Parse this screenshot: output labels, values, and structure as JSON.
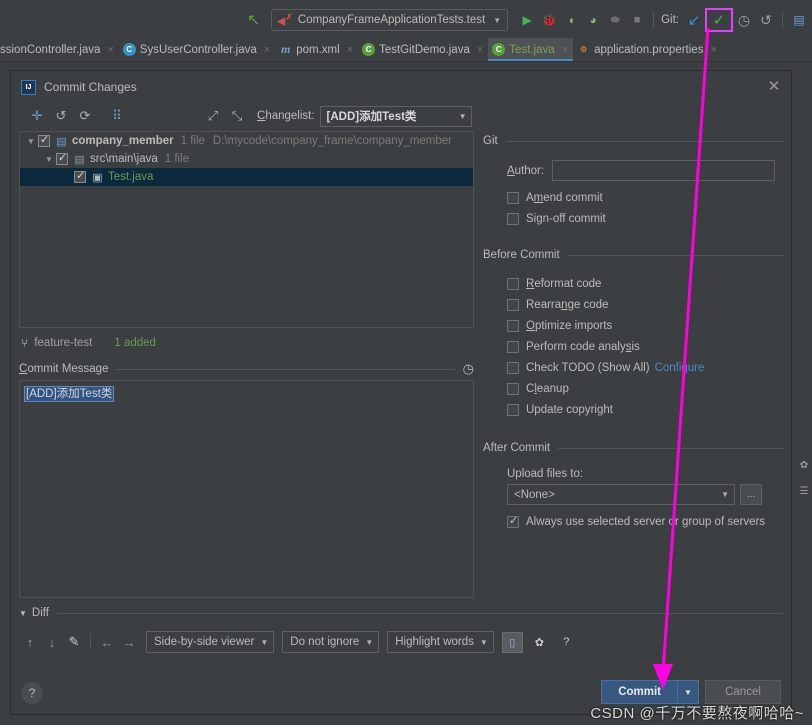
{
  "ide_toolbar": {
    "back_icon": "back-arrow-icon",
    "run_config": {
      "label": "CompanyFrameApplicationTests.test",
      "icon": "test-config-icon",
      "caret": "▼"
    },
    "actions": [
      {
        "name": "run-icon",
        "glyph": "▶",
        "color": "#4caf50"
      },
      {
        "name": "debug-icon",
        "glyph": "🐞",
        "color": "#9fbf58"
      },
      {
        "name": "run-coverage-icon",
        "glyph": "◖",
        "color": "#8fb573"
      },
      {
        "name": "profile-icon",
        "glyph": "◐",
        "color": "#8fb573"
      },
      {
        "name": "attach-icon",
        "glyph": "⬬",
        "color": "#6d6d6d"
      },
      {
        "name": "stop-icon",
        "glyph": "■",
        "color": "#7a7a7a"
      }
    ],
    "git_label": "Git:",
    "git_actions": [
      {
        "name": "update-project-icon",
        "glyph": "↙",
        "color": "#3b8bd6"
      },
      {
        "name": "commit-icon",
        "glyph": "✓",
        "color": "#4caf50",
        "highlighted": true
      },
      {
        "name": "history-icon",
        "glyph": "◷",
        "color": "#bbbbbb"
      },
      {
        "name": "rollback-icon",
        "glyph": "↺",
        "color": "#bbbbbb"
      }
    ],
    "trailing_icon": "project-structure-icon"
  },
  "editor_tabs": [
    {
      "label": "ssionController.java",
      "icon": "class-icon",
      "icon_kind": "cls",
      "icon_text": "C",
      "active": false,
      "close": "×"
    },
    {
      "label": "SysUserController.java",
      "icon": "class-icon",
      "icon_kind": "cls",
      "icon_text": "C",
      "active": false,
      "close": "×"
    },
    {
      "label": "pom.xml",
      "icon": "maven-icon",
      "icon_kind": "maven",
      "icon_text": "m",
      "active": false,
      "close": "×"
    },
    {
      "label": "TestGitDemo.java",
      "icon": "class-icon",
      "icon_kind": "cls-green",
      "icon_text": "C",
      "active": false,
      "close": "×"
    },
    {
      "label": "Test.java",
      "icon": "class-icon",
      "icon_kind": "cls-green",
      "icon_text": "C",
      "active": true,
      "close": "×"
    },
    {
      "label": "application.properties",
      "icon": "properties-icon",
      "icon_kind": "props",
      "icon_text": "⚙",
      "active": false,
      "close": "×"
    }
  ],
  "dialog": {
    "title": "Commit Changes",
    "app_icon": "intellij-idea-icon",
    "close_label": "✕",
    "toolbar": {
      "icons": [
        {
          "name": "add-to-changelist-icon",
          "glyph": "✛"
        },
        {
          "name": "revert-icon",
          "glyph": "↺"
        },
        {
          "name": "refresh-icon",
          "glyph": "⟳"
        },
        {
          "name": "group-by-icon",
          "glyph": "⠿"
        },
        {
          "name": "expand-all-icon",
          "glyph": "⤢"
        },
        {
          "name": "collapse-all-icon",
          "glyph": "⤡"
        }
      ],
      "changelist_label": "Changelist:",
      "changelist_value": "[ADD]添加Test类",
      "changelist_caret": "▼"
    },
    "tree": [
      {
        "indent": 0,
        "twisty": "▼",
        "checked": true,
        "icon": "module-icon",
        "icon_glyph": "▤",
        "name": "company_member",
        "bold": true,
        "green": false,
        "meta": "1 file",
        "path": "D:\\mycode\\company_frame\\company_member",
        "selected": false
      },
      {
        "indent": 1,
        "twisty": "▼",
        "checked": true,
        "icon": "folder-icon",
        "icon_glyph": "▤",
        "name": "src\\main\\java",
        "bold": false,
        "green": false,
        "meta": "1 file",
        "path": "",
        "selected": false
      },
      {
        "indent": 2,
        "twisty": "",
        "checked": true,
        "icon": "java-file-icon",
        "icon_glyph": "▣",
        "name": "Test.java",
        "bold": false,
        "green": true,
        "meta": "",
        "path": "",
        "selected": true
      }
    ],
    "branch": {
      "icon": "branch-icon",
      "glyph": "⑂",
      "name": "feature-test",
      "added": "1 added"
    },
    "commit_message": {
      "label_prefix": "C",
      "label_rest": "ommit Message",
      "history_icon": "clock-icon",
      "history_glyph": "◷",
      "value": "[ADD]添加Test类"
    },
    "git_section": {
      "title": "Git",
      "author_label_prefix": "A",
      "author_label_rest": "uthor:",
      "author_value": "",
      "checkboxes": [
        {
          "label_pre": "A",
          "label_key": "m",
          "label_post": "end commit",
          "checked": false,
          "name": "amend-commit-checkbox"
        },
        {
          "label_pre": "Sign-off commit",
          "label_key": "",
          "label_post": "",
          "checked": false,
          "name": "sign-off-commit-checkbox"
        }
      ]
    },
    "before_commit": {
      "title": "Before Commit",
      "items": [
        {
          "label": "Reformat code",
          "checked": false,
          "link": "",
          "name": "reformat-code-checkbox"
        },
        {
          "label": "Rearrange code",
          "checked": false,
          "link": "",
          "name": "rearrange-code-checkbox"
        },
        {
          "label": "Optimize imports",
          "checked": false,
          "link": "",
          "name": "optimize-imports-checkbox"
        },
        {
          "label": "Perform code analysis",
          "checked": false,
          "link": "",
          "name": "perform-code-analysis-checkbox"
        },
        {
          "label": "Check TODO (Show All)",
          "checked": false,
          "link": "Configure",
          "name": "check-todo-checkbox"
        },
        {
          "label": "Cleanup",
          "checked": false,
          "link": "",
          "name": "cleanup-checkbox"
        },
        {
          "label": "Update copyright",
          "checked": false,
          "link": "",
          "name": "update-copyright-checkbox"
        }
      ]
    },
    "after_commit": {
      "title": "After Commit",
      "upload_label": "Upload files to:",
      "upload_value": "<None>",
      "upload_caret": "▼",
      "browse_label": "...",
      "always_use_label": "Always use selected server or group of servers",
      "always_use_checked": true
    },
    "diff": {
      "title": "Diff",
      "twisty": "▼",
      "nav_icons": [
        {
          "name": "previous-difference-icon",
          "glyph": "↑"
        },
        {
          "name": "next-difference-icon",
          "glyph": "↓"
        },
        {
          "name": "edit-source-icon",
          "glyph": "✎"
        },
        {
          "name": "apply-left-icon",
          "glyph": "←"
        },
        {
          "name": "apply-right-icon",
          "glyph": "→"
        }
      ],
      "viewer_mode": "Side-by-side viewer",
      "ignore_mode": "Do not ignore",
      "highlight_mode": "Highlight words",
      "caret": "▼",
      "lock_icon": "lock-icon",
      "lock_glyph": "🔒",
      "settings_icon": "gear-icon",
      "settings_glyph": "✿",
      "help_glyph": "?"
    },
    "footer": {
      "help_label": "?",
      "commit_label": "Commit",
      "commit_caret": "▼",
      "cancel_label": "Cancel"
    }
  },
  "right_strip_icons": [
    {
      "name": "gear-icon",
      "glyph": "✿"
    },
    {
      "name": "layout-icon",
      "glyph": "☰"
    }
  ],
  "annotation": {
    "arrow_color": "#ff00e0",
    "watermark": "CSDN @千万不要熬夜啊哈哈~"
  }
}
